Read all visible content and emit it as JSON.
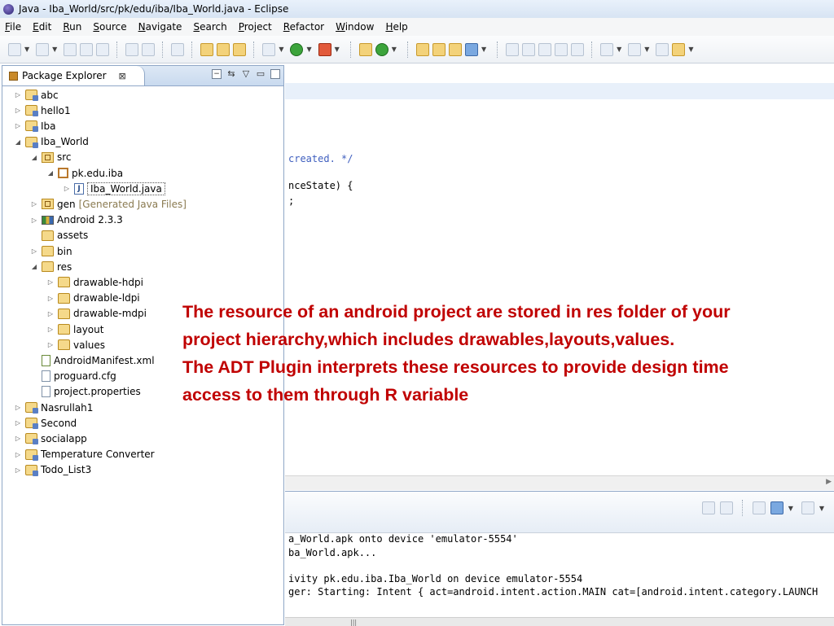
{
  "window": {
    "title": "Java - Iba_World/src/pk/edu/iba/Iba_World.java - Eclipse"
  },
  "menu": [
    "File",
    "Edit",
    "Run",
    "Source",
    "Navigate",
    "Search",
    "Project",
    "Refactor",
    "Window",
    "Help"
  ],
  "explorer": {
    "tab_label": "Package Explorer",
    "tab_close": "⊠",
    "items": [
      {
        "label": "abc",
        "arrow": "▷",
        "icon": "project-icon",
        "indent": 0
      },
      {
        "label": "hello1",
        "arrow": "▷",
        "icon": "project-icon",
        "indent": 0
      },
      {
        "label": "Iba",
        "arrow": "▷",
        "icon": "project-icon",
        "indent": 0
      },
      {
        "label": "Iba_World",
        "arrow": "◢",
        "icon": "project-icon",
        "indent": 0
      },
      {
        "label": "src",
        "arrow": "◢",
        "icon": "source-folder-icon",
        "indent": 1
      },
      {
        "label": "pk.edu.iba",
        "arrow": "◢",
        "icon": "package-icon",
        "indent": 2
      },
      {
        "label": "Iba_World.java",
        "arrow": "▷",
        "icon": "java-file-icon",
        "indent": 3
      },
      {
        "label": "gen",
        "decoration": "[Generated Java Files]",
        "arrow": "▷",
        "icon": "source-folder-icon",
        "indent": 1
      },
      {
        "label": "Android 2.3.3",
        "arrow": "▷",
        "icon": "library-icon",
        "indent": 1
      },
      {
        "label": "assets",
        "arrow": "",
        "icon": "folder-icon",
        "indent": 1
      },
      {
        "label": "bin",
        "arrow": "▷",
        "icon": "folder-icon",
        "indent": 1
      },
      {
        "label": "res",
        "arrow": "◢",
        "icon": "folder-icon",
        "indent": 1
      },
      {
        "label": "drawable-hdpi",
        "arrow": "▷",
        "icon": "folder-icon",
        "indent": 2
      },
      {
        "label": "drawable-ldpi",
        "arrow": "▷",
        "icon": "folder-icon",
        "indent": 2
      },
      {
        "label": "drawable-mdpi",
        "arrow": "▷",
        "icon": "folder-icon",
        "indent": 2
      },
      {
        "label": "layout",
        "arrow": "▷",
        "icon": "folder-icon",
        "indent": 2
      },
      {
        "label": "values",
        "arrow": "▷",
        "icon": "folder-icon",
        "indent": 2
      },
      {
        "label": "AndroidManifest.xml",
        "arrow": "",
        "icon": "xml-file-icon",
        "indent": 1
      },
      {
        "label": "proguard.cfg",
        "arrow": "",
        "icon": "file-icon",
        "indent": 1
      },
      {
        "label": "project.properties",
        "arrow": "",
        "icon": "file-icon",
        "indent": 1
      },
      {
        "label": "Nasrullah1",
        "arrow": "▷",
        "icon": "project-icon",
        "indent": 0
      },
      {
        "label": "Second",
        "arrow": "▷",
        "icon": "project-icon",
        "indent": 0
      },
      {
        "label": "socialapp",
        "arrow": "▷",
        "icon": "project-icon",
        "indent": 0
      },
      {
        "label": "Temperature Converter",
        "arrow": "▷",
        "icon": "project-icon",
        "indent": 0
      },
      {
        "label": "Todo_List3",
        "arrow": "▷",
        "icon": "project-icon",
        "indent": 0
      }
    ]
  },
  "editor": {
    "line1": "created. */",
    "line2": "nceState) {",
    "line3": ";"
  },
  "console": {
    "line1": "a_World.apk onto device 'emulator-5554'",
    "line2": "ba_World.apk...",
    "line3": "ivity pk.edu.iba.Iba_World on device emulator-5554",
    "line4": "ger: Starting: Intent { act=android.intent.action.MAIN cat=[android.intent.category.LAUNCH",
    "scroll_thumb": "|||"
  },
  "annotation": {
    "para1": "The resource of an android project are stored in res folder of your  project hierarchy,which includes drawables,layouts,values.",
    "para2": "The ADT Plugin  interprets these resources to provide design time  access  to them through R variable"
  },
  "colors": {
    "annotation": "#c00000",
    "comment": "#3f5fbf"
  }
}
